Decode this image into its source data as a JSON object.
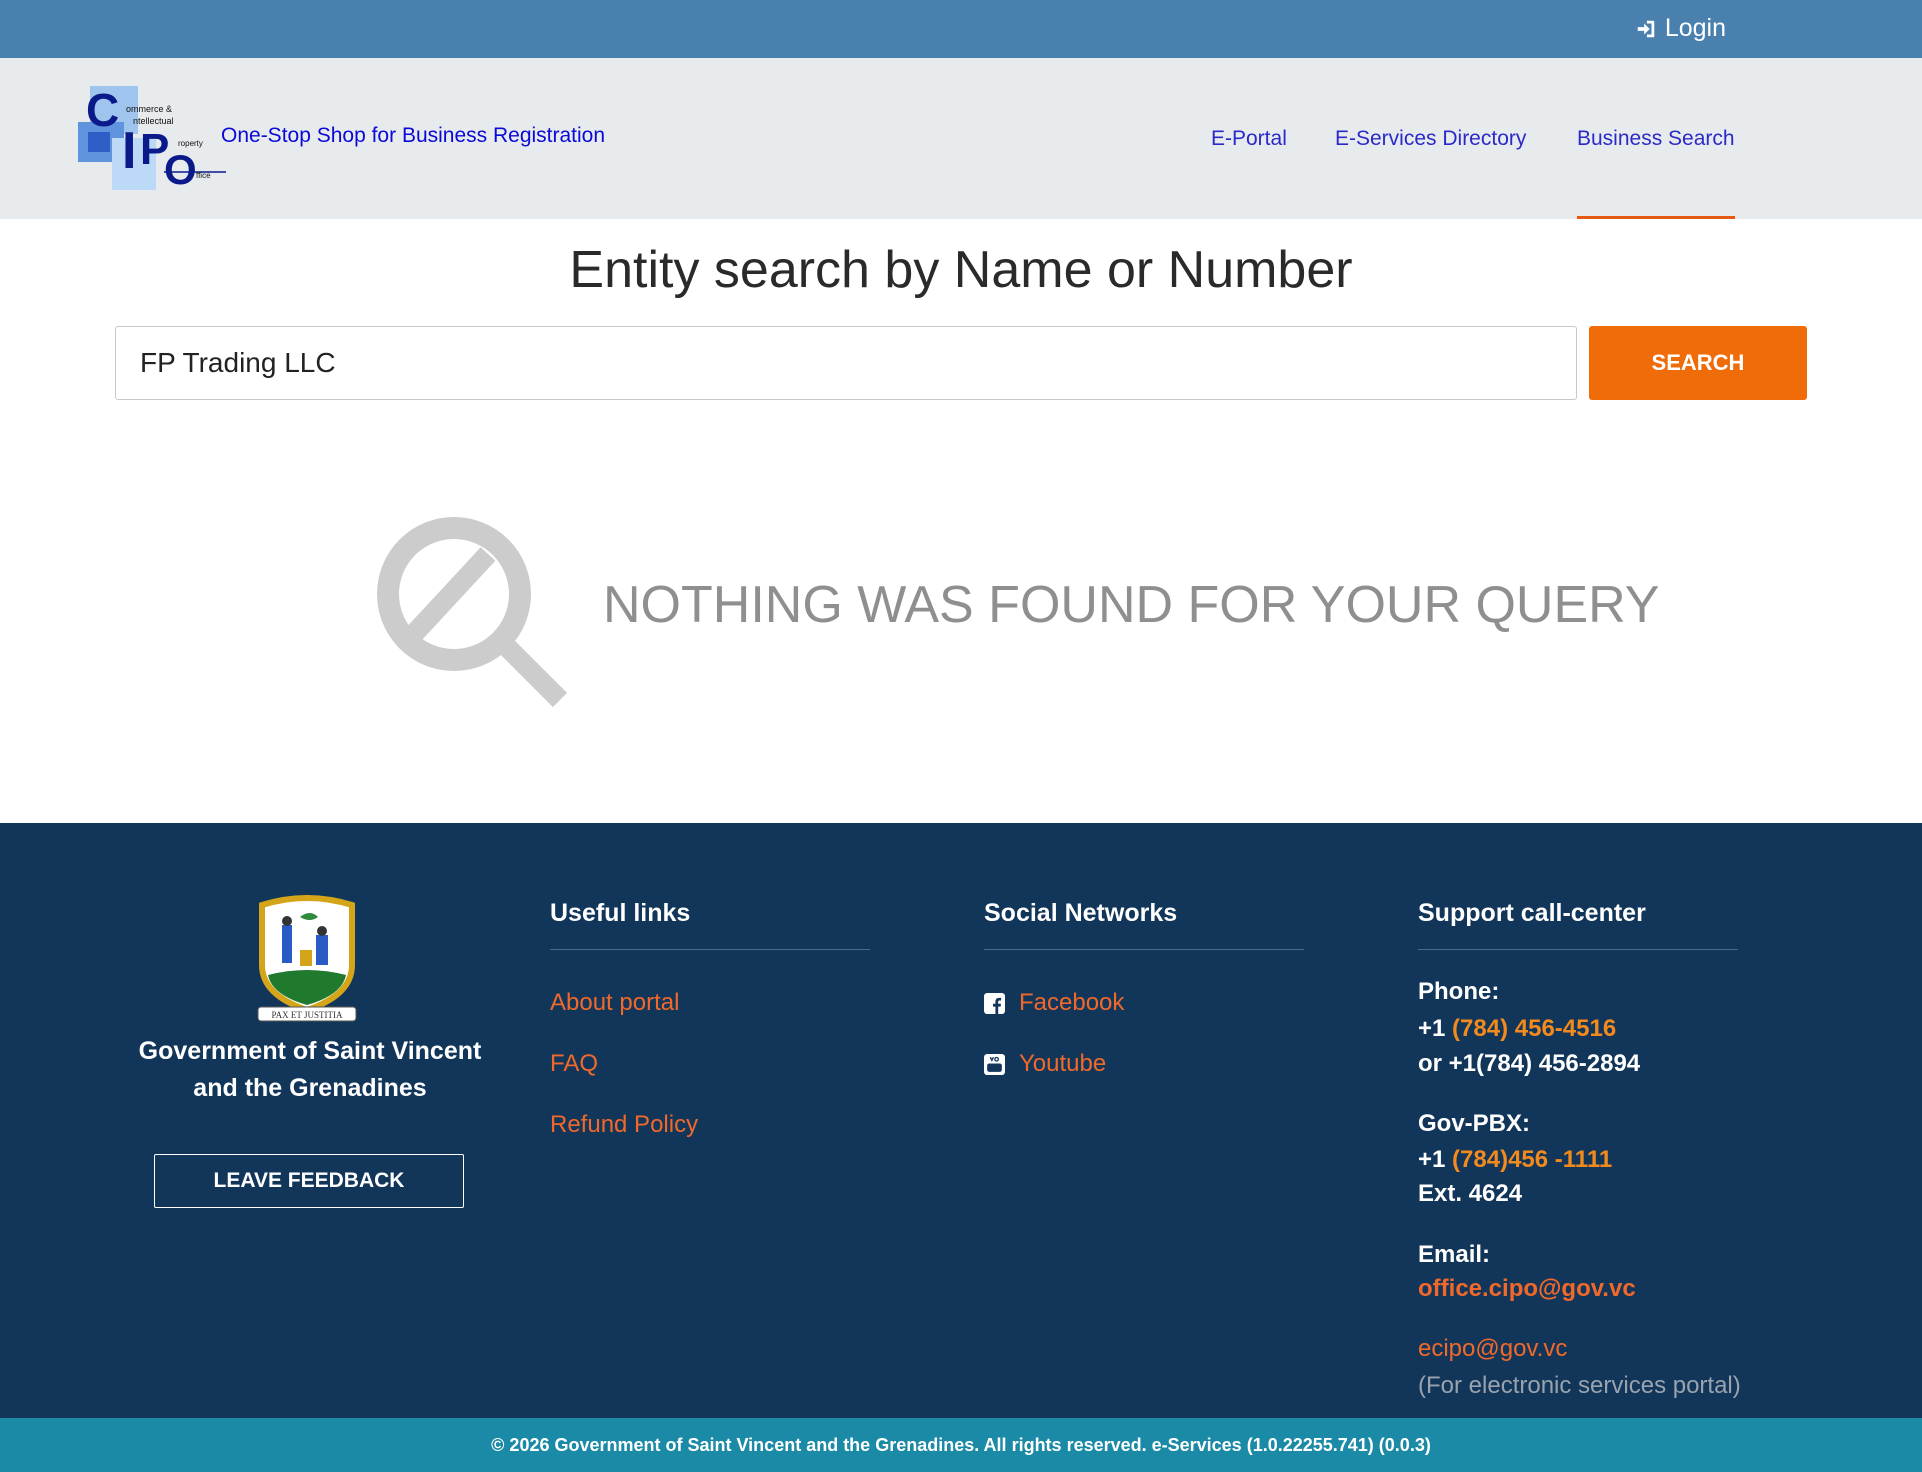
{
  "topbar": {
    "login_label": "Login",
    "login_icon": "sign-in-icon"
  },
  "header": {
    "logo": {
      "big_letters": [
        "C",
        "I",
        "P",
        "O"
      ],
      "words": [
        "ommerce &",
        "ntellectual",
        "roperty",
        "ffice"
      ]
    },
    "tagline": "One-Stop Shop for Business Registration",
    "nav": [
      {
        "label": "E-Portal"
      },
      {
        "label": "E-Services Directory"
      },
      {
        "label": "Business Search",
        "active": true
      }
    ]
  },
  "search": {
    "title": "Entity search by Name or Number",
    "query": "FP Trading LLC",
    "button_label": "SEARCH"
  },
  "result": {
    "message": "NOTHING WAS FOUND FOR YOUR QUERY",
    "icon": "no-results-search-icon"
  },
  "footer": {
    "government": {
      "motto": "PAX ET JUSTITIA",
      "name": "Government of Saint Vincent and the Grenadines",
      "feedback_label": "LEAVE FEEDBACK"
    },
    "useful_links": {
      "heading": "Useful links",
      "items": [
        "About portal",
        "FAQ",
        "Refund Policy"
      ]
    },
    "social": {
      "heading": "Social Networks",
      "items": [
        {
          "label": "Facebook",
          "icon": "facebook-icon"
        },
        {
          "label": "Youtube",
          "icon": "youtube-icon"
        }
      ]
    },
    "support": {
      "heading": "Support call-center",
      "phone_label": "Phone:",
      "phone_prefix": "+1",
      "phone_number": "(784) 456-4516",
      "phone_alt": "or +1(784) 456-2894",
      "pbx_label": "Gov-PBX:",
      "pbx_prefix": "+1",
      "pbx_number": "(784)456 -1111",
      "pbx_ext": "Ext. 4624",
      "email_label": "Email:",
      "email_primary": "office.cipo@gov.vc",
      "email_secondary": "ecipo@gov.vc",
      "email_secondary_note": "(For electronic services portal)"
    }
  },
  "copyright": "© 2026 Government of Saint Vincent and the Grenadines. All rights reserved. e-Services (1.0.22255.741) (0.0.3)",
  "colors": {
    "topbar": "#4a80ae",
    "header_bg": "#e8ebee",
    "accent_orange": "#f06c09",
    "footer_bg": "#12365a",
    "copyright_bg": "#1b8aa6",
    "link_blue": "#2a2ac8"
  }
}
